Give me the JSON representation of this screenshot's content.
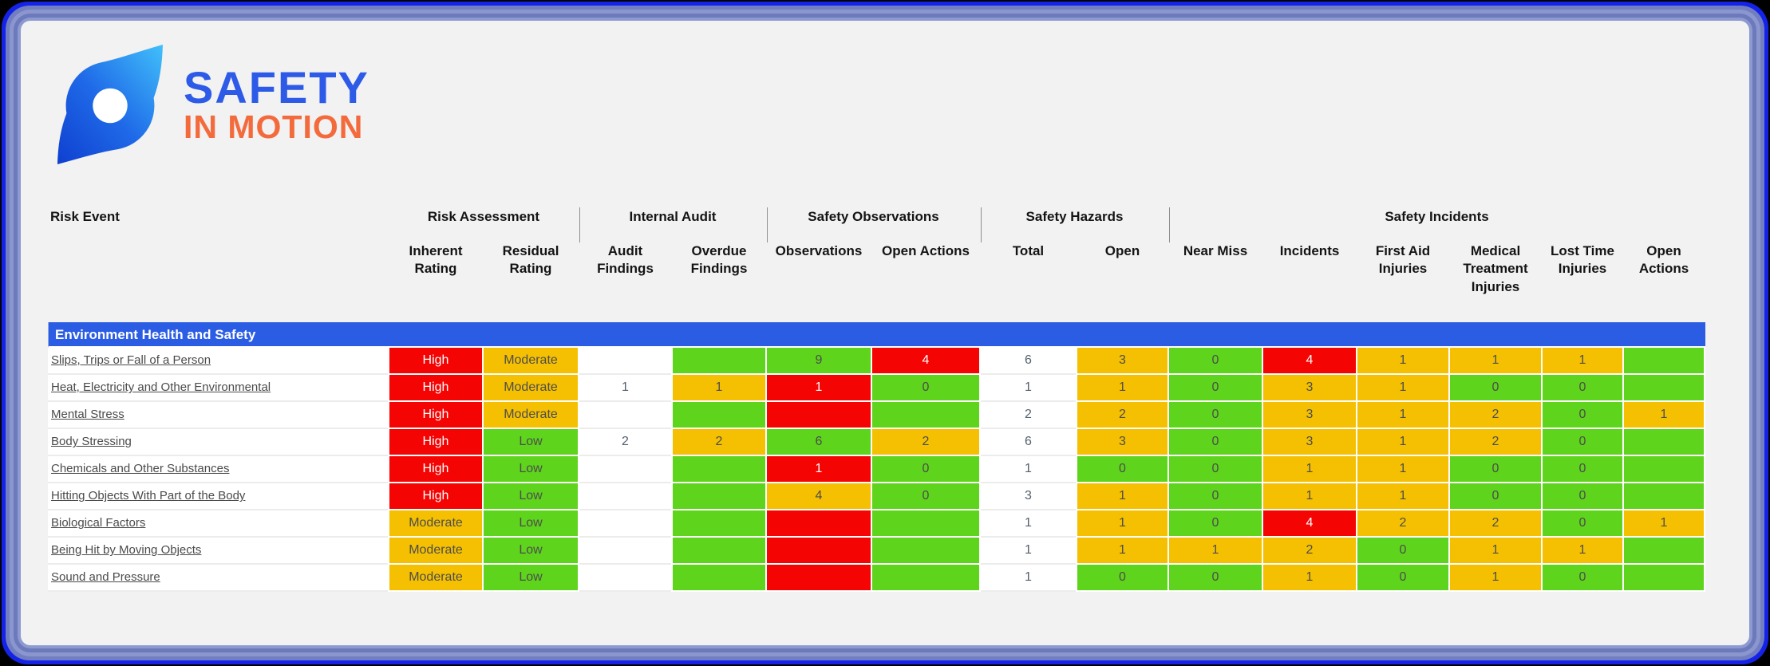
{
  "logo": {
    "icon": "compass-swirl-icon",
    "title": "SAFETY",
    "subtitle": "IN MOTION",
    "title_color": "#2d5be8",
    "subtitle_color": "#f36b3c"
  },
  "table": {
    "row_header": "Risk Event",
    "groups": [
      {
        "label": "Risk Assessment",
        "span": 2
      },
      {
        "label": "Internal Audit",
        "span": 2
      },
      {
        "label": "Safety Observations",
        "span": 2
      },
      {
        "label": "Safety Hazards",
        "span": 2
      },
      {
        "label": "Safety Incidents",
        "span": 6
      }
    ],
    "columns": [
      "Inherent Rating",
      "Residual Rating",
      "Audit Findings",
      "Overdue Findings",
      "Observations",
      "Open Actions",
      "Total",
      "Open",
      "Near Miss",
      "Incidents",
      "First Aid Injuries",
      "Medical Treatment Injuries",
      "Lost Time Injuries",
      "Open Actions"
    ],
    "section": "Environment Health and Safety",
    "status_colors": {
      "red": "#f50404",
      "amber": "#f5c001",
      "green": "#5ed41c",
      "white": "#ffffff",
      "section_blue": "#2b5ce4"
    },
    "rows": [
      {
        "label": "Slips, Trips or Fall of a Person",
        "cells": [
          {
            "v": "High",
            "c": "red"
          },
          {
            "v": "Moderate",
            "c": "amber"
          },
          {
            "v": "",
            "c": "white"
          },
          {
            "v": "",
            "c": "green"
          },
          {
            "v": "9",
            "c": "green"
          },
          {
            "v": "4",
            "c": "red"
          },
          {
            "v": "6",
            "c": "white"
          },
          {
            "v": "3",
            "c": "amber"
          },
          {
            "v": "0",
            "c": "green"
          },
          {
            "v": "4",
            "c": "red"
          },
          {
            "v": "1",
            "c": "amber"
          },
          {
            "v": "1",
            "c": "amber"
          },
          {
            "v": "1",
            "c": "amber"
          },
          {
            "v": "",
            "c": "green"
          }
        ]
      },
      {
        "label": "Heat, Electricity and Other Environmental",
        "cells": [
          {
            "v": "High",
            "c": "red"
          },
          {
            "v": "Moderate",
            "c": "amber"
          },
          {
            "v": "1",
            "c": "white"
          },
          {
            "v": "1",
            "c": "amber"
          },
          {
            "v": "1",
            "c": "red"
          },
          {
            "v": "0",
            "c": "green"
          },
          {
            "v": "1",
            "c": "white"
          },
          {
            "v": "1",
            "c": "amber"
          },
          {
            "v": "0",
            "c": "green"
          },
          {
            "v": "3",
            "c": "amber"
          },
          {
            "v": "1",
            "c": "amber"
          },
          {
            "v": "0",
            "c": "green"
          },
          {
            "v": "0",
            "c": "green"
          },
          {
            "v": "",
            "c": "green"
          }
        ]
      },
      {
        "label": "Mental Stress",
        "cells": [
          {
            "v": "High",
            "c": "red"
          },
          {
            "v": "Moderate",
            "c": "amber"
          },
          {
            "v": "",
            "c": "white"
          },
          {
            "v": "",
            "c": "green"
          },
          {
            "v": "",
            "c": "red"
          },
          {
            "v": "",
            "c": "green"
          },
          {
            "v": "2",
            "c": "white"
          },
          {
            "v": "2",
            "c": "amber"
          },
          {
            "v": "0",
            "c": "green"
          },
          {
            "v": "3",
            "c": "amber"
          },
          {
            "v": "1",
            "c": "amber"
          },
          {
            "v": "2",
            "c": "amber"
          },
          {
            "v": "0",
            "c": "green"
          },
          {
            "v": "1",
            "c": "amber"
          }
        ]
      },
      {
        "label": "Body Stressing",
        "cells": [
          {
            "v": "High",
            "c": "red"
          },
          {
            "v": "Low",
            "c": "green"
          },
          {
            "v": "2",
            "c": "white"
          },
          {
            "v": "2",
            "c": "amber"
          },
          {
            "v": "6",
            "c": "green"
          },
          {
            "v": "2",
            "c": "amber"
          },
          {
            "v": "6",
            "c": "white"
          },
          {
            "v": "3",
            "c": "amber"
          },
          {
            "v": "0",
            "c": "green"
          },
          {
            "v": "3",
            "c": "amber"
          },
          {
            "v": "1",
            "c": "amber"
          },
          {
            "v": "2",
            "c": "amber"
          },
          {
            "v": "0",
            "c": "green"
          },
          {
            "v": "",
            "c": "green"
          }
        ]
      },
      {
        "label": "Chemicals and Other Substances",
        "cells": [
          {
            "v": "High",
            "c": "red"
          },
          {
            "v": "Low",
            "c": "green"
          },
          {
            "v": "",
            "c": "white"
          },
          {
            "v": "",
            "c": "green"
          },
          {
            "v": "1",
            "c": "red"
          },
          {
            "v": "0",
            "c": "green"
          },
          {
            "v": "1",
            "c": "white"
          },
          {
            "v": "0",
            "c": "green"
          },
          {
            "v": "0",
            "c": "green"
          },
          {
            "v": "1",
            "c": "amber"
          },
          {
            "v": "1",
            "c": "amber"
          },
          {
            "v": "0",
            "c": "green"
          },
          {
            "v": "0",
            "c": "green"
          },
          {
            "v": "",
            "c": "green"
          }
        ]
      },
      {
        "label": "Hitting Objects With Part of the Body",
        "cells": [
          {
            "v": "High",
            "c": "red"
          },
          {
            "v": "Low",
            "c": "green"
          },
          {
            "v": "",
            "c": "white"
          },
          {
            "v": "",
            "c": "green"
          },
          {
            "v": "4",
            "c": "amber"
          },
          {
            "v": "0",
            "c": "green"
          },
          {
            "v": "3",
            "c": "white"
          },
          {
            "v": "1",
            "c": "amber"
          },
          {
            "v": "0",
            "c": "green"
          },
          {
            "v": "1",
            "c": "amber"
          },
          {
            "v": "1",
            "c": "amber"
          },
          {
            "v": "0",
            "c": "green"
          },
          {
            "v": "0",
            "c": "green"
          },
          {
            "v": "",
            "c": "green"
          }
        ]
      },
      {
        "label": "Biological Factors",
        "cells": [
          {
            "v": "Moderate",
            "c": "amber"
          },
          {
            "v": "Low",
            "c": "green"
          },
          {
            "v": "",
            "c": "white"
          },
          {
            "v": "",
            "c": "green"
          },
          {
            "v": "",
            "c": "red"
          },
          {
            "v": "",
            "c": "green"
          },
          {
            "v": "1",
            "c": "white"
          },
          {
            "v": "1",
            "c": "amber"
          },
          {
            "v": "0",
            "c": "green"
          },
          {
            "v": "4",
            "c": "red"
          },
          {
            "v": "2",
            "c": "amber"
          },
          {
            "v": "2",
            "c": "amber"
          },
          {
            "v": "0",
            "c": "green"
          },
          {
            "v": "1",
            "c": "amber"
          }
        ]
      },
      {
        "label": "Being Hit by Moving Objects",
        "cells": [
          {
            "v": "Moderate",
            "c": "amber"
          },
          {
            "v": "Low",
            "c": "green"
          },
          {
            "v": "",
            "c": "white"
          },
          {
            "v": "",
            "c": "green"
          },
          {
            "v": "",
            "c": "red"
          },
          {
            "v": "",
            "c": "green"
          },
          {
            "v": "1",
            "c": "white"
          },
          {
            "v": "1",
            "c": "amber"
          },
          {
            "v": "1",
            "c": "amber"
          },
          {
            "v": "2",
            "c": "amber"
          },
          {
            "v": "0",
            "c": "green"
          },
          {
            "v": "1",
            "c": "amber"
          },
          {
            "v": "1",
            "c": "amber"
          },
          {
            "v": "",
            "c": "green"
          }
        ]
      },
      {
        "label": "Sound and Pressure",
        "cells": [
          {
            "v": "Moderate",
            "c": "amber"
          },
          {
            "v": "Low",
            "c": "green"
          },
          {
            "v": "",
            "c": "white"
          },
          {
            "v": "",
            "c": "green"
          },
          {
            "v": "",
            "c": "red"
          },
          {
            "v": "",
            "c": "green"
          },
          {
            "v": "1",
            "c": "white"
          },
          {
            "v": "0",
            "c": "green"
          },
          {
            "v": "0",
            "c": "green"
          },
          {
            "v": "1",
            "c": "amber"
          },
          {
            "v": "0",
            "c": "green"
          },
          {
            "v": "1",
            "c": "amber"
          },
          {
            "v": "0",
            "c": "green"
          },
          {
            "v": "",
            "c": "green"
          }
        ]
      }
    ]
  }
}
